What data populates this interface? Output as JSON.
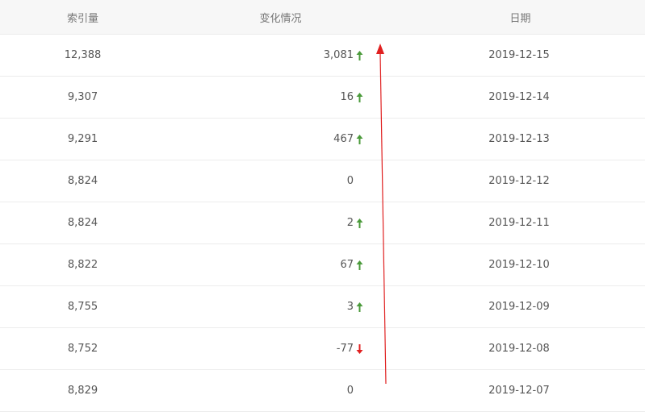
{
  "headers": {
    "count": "索引量",
    "change": "变化情况",
    "date": "日期"
  },
  "colors": {
    "up": "#4a9a3a",
    "down": "#e02020",
    "annotation": "#e02020"
  },
  "rows": [
    {
      "count": "12,388",
      "change": "3,081",
      "trend": "up",
      "date": "2019-12-15"
    },
    {
      "count": "9,307",
      "change": "16",
      "trend": "up",
      "date": "2019-12-14"
    },
    {
      "count": "9,291",
      "change": "467",
      "trend": "up",
      "date": "2019-12-13"
    },
    {
      "count": "8,824",
      "change": "0",
      "trend": "none",
      "date": "2019-12-12"
    },
    {
      "count": "8,824",
      "change": "2",
      "trend": "up",
      "date": "2019-12-11"
    },
    {
      "count": "8,822",
      "change": "67",
      "trend": "up",
      "date": "2019-12-10"
    },
    {
      "count": "8,755",
      "change": "3",
      "trend": "up",
      "date": "2019-12-09"
    },
    {
      "count": "8,752",
      "change": "-77",
      "trend": "down",
      "date": "2019-12-08"
    },
    {
      "count": "8,829",
      "change": "0",
      "trend": "none",
      "date": "2019-12-07"
    }
  ],
  "icons": {
    "up": "arrow-up-icon",
    "down": "arrow-down-icon",
    "annotation": "red-annotation-arrow"
  }
}
